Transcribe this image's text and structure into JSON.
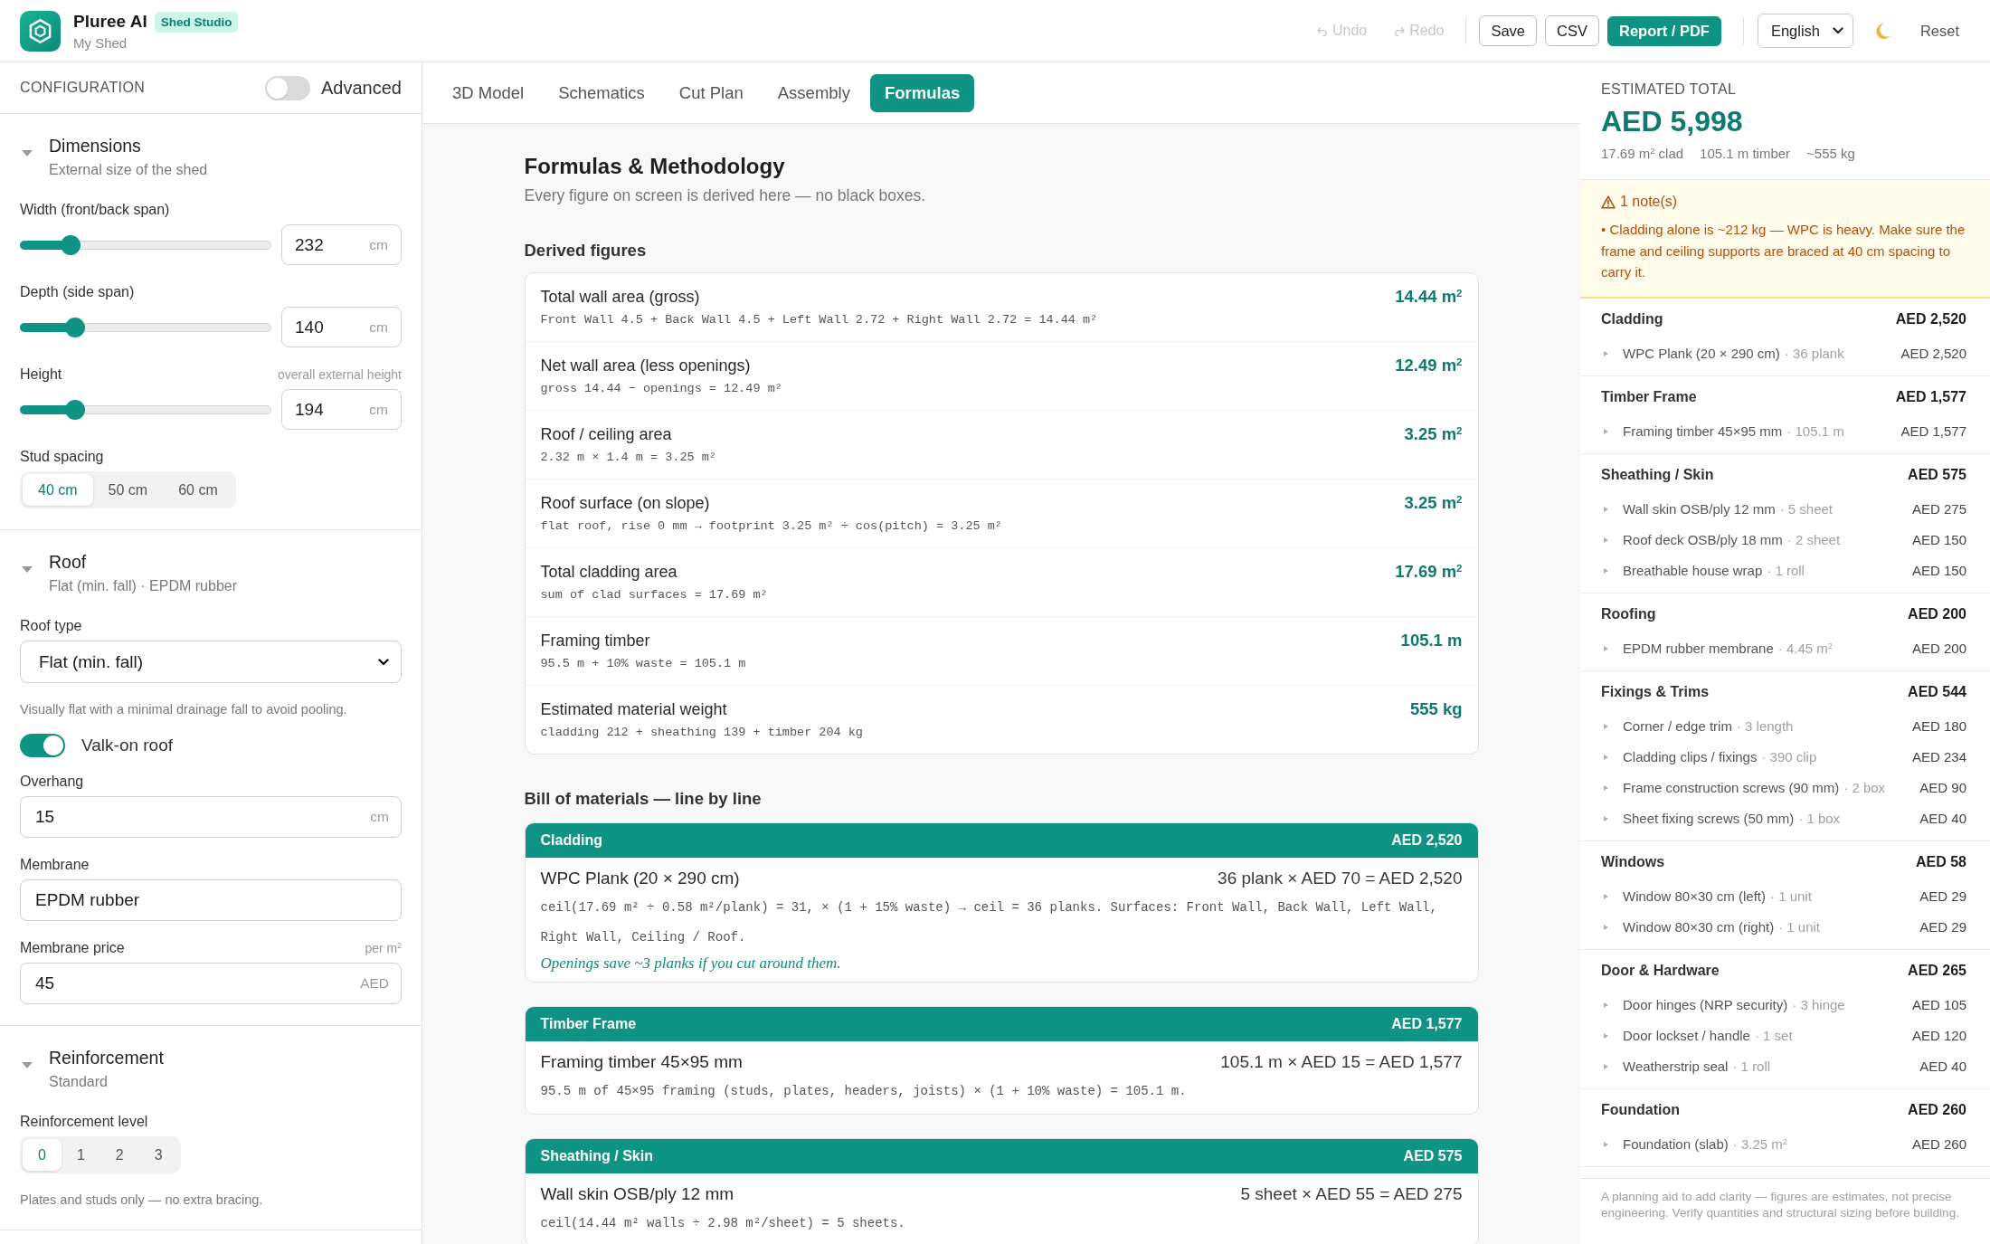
{
  "header": {
    "app_name": "Pluree AI",
    "badge": "Shed Studio",
    "project": "My Shed"
  },
  "toolbar": {
    "history": [
      {
        "kind": "undo",
        "label": "Undo",
        "disabled": true
      },
      {
        "kind": "redo",
        "label": "Redo",
        "disabled": true
      }
    ],
    "buttons": [
      {
        "kind": "outline",
        "label": "Save"
      },
      {
        "kind": "outline",
        "label": "CSV"
      },
      {
        "kind": "primary",
        "label": "Report / PDF"
      }
    ],
    "language": "English",
    "reset": "Reset"
  },
  "config": {
    "title": "CONFIGURATION",
    "advanced": {
      "label": "Advanced",
      "on": false
    },
    "sections": [
      {
        "title": "Dimensions",
        "subtitle": "External size of the shed",
        "expanded": true,
        "fields": [
          {
            "kind": "slider",
            "label": "Width (front/back span)",
            "level": 0.2,
            "value": "232",
            "unit": "cm"
          },
          {
            "kind": "slider",
            "label": "Depth (side span)",
            "level": 0.22,
            "value": "140",
            "unit": "cm"
          },
          {
            "kind": "slider",
            "label": "Height",
            "hint": "overall external height",
            "level": 0.22,
            "value": "194",
            "unit": "cm"
          },
          {
            "kind": "segmented",
            "label": "Stud spacing",
            "options": [
              {
                "label": "40 cm",
                "selected": true
              },
              {
                "label": "50 cm",
                "selected": false
              },
              {
                "label": "60 cm",
                "selected": false
              }
            ]
          }
        ]
      },
      {
        "title": "Roof",
        "subtitle": "Flat (min. fall) · EPDM rubber",
        "expanded": true,
        "fields": [
          {
            "kind": "select",
            "label": "Roof type",
            "value": "Flat (min. fall)"
          },
          {
            "kind": "note",
            "text": "Visually flat with a minimal drainage fall to avoid pooling."
          },
          {
            "kind": "toggle",
            "label": "Valk-on roof",
            "on": true
          },
          {
            "kind": "input",
            "label": "Overhang",
            "value": "15",
            "unit": "cm"
          },
          {
            "kind": "input",
            "label": "Membrane",
            "value": "EPDM rubber"
          },
          {
            "kind": "input",
            "label": "Membrane price",
            "hint": "per m$^{2}$",
            "value": "45",
            "unit": "AED"
          }
        ]
      },
      {
        "title": "Reinforcement",
        "subtitle": "Standard",
        "expanded": true,
        "fields": [
          {
            "kind": "segmented",
            "label": "Reinforcement level",
            "options": [
              {
                "label": "0",
                "selected": true
              },
              {
                "label": "1",
                "selected": false
              },
              {
                "label": "2",
                "selected": false
              },
              {
                "label": "3",
                "selected": false
              }
            ]
          },
          {
            "kind": "note",
            "text": "Plates and studs only — no extra bracing."
          }
        ]
      }
    ]
  },
  "tabs": [
    {
      "label": "3D Model",
      "selected": false
    },
    {
      "label": "Schematics",
      "selected": false
    },
    {
      "label": "Cut Plan",
      "selected": false
    },
    {
      "label": "Assembly",
      "selected": false
    },
    {
      "label": "Formulas",
      "selected": true
    }
  ],
  "formulas": {
    "title": "Formulas & Methodology",
    "subtitle": "Every figure on screen is derived here — no black boxes.",
    "derived_title": "Derived figures",
    "derived": [
      {
        "label": "Total wall area (gross)",
        "formula": "Front Wall 4.5 + Back Wall 4.5 + Left Wall 2.72 + Right Wall 2.72 = 14.44 m²",
        "value": "14.44 m$^{2}$"
      },
      {
        "label": "Net wall area (less openings)",
        "formula": "gross 14.44 − openings = 12.49 m²",
        "value": "12.49 m$^{2}$"
      },
      {
        "label": "Roof / ceiling area",
        "formula": "2.32 m × 1.4 m = 3.25 m²",
        "value": "3.25 m$^{2}$"
      },
      {
        "label": "Roof surface (on slope)",
        "formula": "flat roof, rise 0 mm → footprint 3.25 m² ÷ cos(pitch) = 3.25 m²",
        "value": "3.25 m$^{2}$"
      },
      {
        "label": "Total cladding area",
        "formula": "sum of clad surfaces = 17.69 m²",
        "value": "17.69 m$^{2}$"
      },
      {
        "label": "Framing timber",
        "formula": "95.5 m + 10% waste = 105.1 m",
        "value": "105.1 m"
      },
      {
        "label": "Estimated material weight",
        "formula": "cladding 212 + sheathing 139 + timber 204 kg",
        "value": "555 kg"
      }
    ],
    "bom_title": "Bill of materials — line by line",
    "bom": [
      {
        "category": "Cladding",
        "total": "AED 2,520",
        "lines": [
          {
            "name": "WPC Plank (20 × 290 cm)",
            "calc": "36 plank × AED 70 = AED 2,520",
            "formula": "ceil(17.69 m² ÷ 0.58 m²/plank) = 31, × (1 + 15% waste) → ceil = 36 planks. Surfaces: Front Wall, Back Wall, Left Wall, Right Wall, Ceiling / Roof.",
            "note": "Openings save ~3 planks if you cut around them."
          }
        ]
      },
      {
        "category": "Timber Frame",
        "total": "AED 1,577",
        "lines": [
          {
            "name": "Framing timber 45×95 mm",
            "calc": "105.1 m × AED 15 = AED 1,577",
            "formula": "95.5 m of 45×95 framing (studs, plates, headers, joists) × (1 + 10% waste) = 105.1 m."
          }
        ]
      },
      {
        "category": "Sheathing / Skin",
        "total": "AED 575",
        "lines": [
          {
            "name": "Wall skin OSB/ply 12 mm",
            "calc": "5 sheet × AED 55 = AED 275",
            "formula": "ceil(14.44 m² walls ÷ 2.98 m²/sheet) = 5 sheets."
          }
        ]
      }
    ]
  },
  "summary": {
    "label": "ESTIMATED TOTAL",
    "total": "AED 5,998",
    "stats": [
      "17.69 m$^{2}$ clad",
      "105.1 m timber",
      "~555 kg"
    ],
    "notes": {
      "title": "1 note(s)",
      "items": [
        "• Cladding alone is ~212 kg — WPC is heavy. Make sure the frame and ceiling supports are braced at 40 cm spacing to carry it."
      ]
    },
    "groups": [
      {
        "name": "Cladding",
        "total": "AED 2,520",
        "items": [
          {
            "name": "WPC Plank (20 × 290 cm)",
            "qty": "· 36 plank",
            "amount": "AED 2,520"
          }
        ]
      },
      {
        "name": "Timber Frame",
        "total": "AED 1,577",
        "items": [
          {
            "name": "Framing timber 45×95 mm",
            "qty": "· 105.1 m",
            "amount": "AED 1,577"
          }
        ]
      },
      {
        "name": "Sheathing / Skin",
        "total": "AED 575",
        "items": [
          {
            "name": "Wall skin OSB/ply 12 mm",
            "qty": "· 5 sheet",
            "amount": "AED 275"
          },
          {
            "name": "Roof deck OSB/ply 18 mm",
            "qty": "· 2 sheet",
            "amount": "AED 150"
          },
          {
            "name": "Breathable house wrap",
            "qty": "· 1 roll",
            "amount": "AED 150"
          }
        ]
      },
      {
        "name": "Roofing",
        "total": "AED 200",
        "items": [
          {
            "name": "EPDM rubber membrane",
            "qty": "· 4.45 m$^{2}$",
            "amount": "AED 200"
          }
        ]
      },
      {
        "name": "Fixings & Trims",
        "total": "AED 544",
        "items": [
          {
            "name": "Corner / edge trim",
            "qty": "· 3 length",
            "amount": "AED 180"
          },
          {
            "name": "Cladding clips / fixings",
            "qty": "· 390 clip",
            "amount": "AED 234"
          },
          {
            "name": "Frame construction screws (90 mm)",
            "qty": "· 2 box",
            "amount": "AED 90"
          },
          {
            "name": "Sheet fixing screws (50 mm)",
            "qty": "· 1 box",
            "amount": "AED 40"
          }
        ]
      },
      {
        "name": "Windows",
        "total": "AED 58",
        "items": [
          {
            "name": "Window 80×30 cm (left)",
            "qty": "· 1 unit",
            "amount": "AED 29"
          },
          {
            "name": "Window 80×30 cm (right)",
            "qty": "· 1 unit",
            "amount": "AED 29"
          }
        ]
      },
      {
        "name": "Door & Hardware",
        "total": "AED 265",
        "items": [
          {
            "name": "Door hinges (NRP security)",
            "qty": "· 3 hinge",
            "amount": "AED 105"
          },
          {
            "name": "Door lockset / handle",
            "qty": "· 1 set",
            "amount": "AED 120"
          },
          {
            "name": "Weatherstrip seal",
            "qty": "· 1 roll",
            "amount": "AED 40"
          }
        ]
      },
      {
        "name": "Foundation",
        "total": "AED 260",
        "items": [
          {
            "name": "Foundation (slab)",
            "qty": "· 3.25 m$^{2}$",
            "amount": "AED 260"
          }
        ]
      }
    ],
    "footer": "A planning aid to add clarity — figures are estimates, not precise engineering. Verify quantities and structural sizing before building."
  }
}
